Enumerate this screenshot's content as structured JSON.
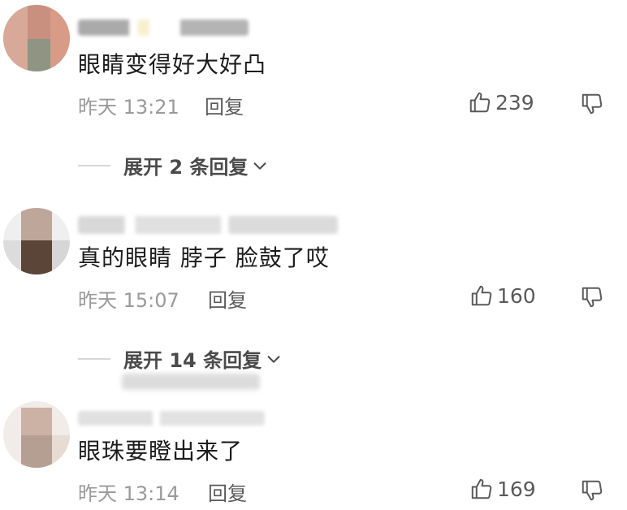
{
  "comments": [
    {
      "text": "眼睛变得好大好凸",
      "time": "昨天 13:21",
      "reply_label": "回复",
      "likes": "239",
      "expand_label": "展开 2 条回复"
    },
    {
      "text": "真的眼睛 脖子 脸鼓了哎",
      "time": "昨天 15:07",
      "reply_label": "回复",
      "likes": "160",
      "expand_label": "展开 14 条回复"
    },
    {
      "text": "眼珠要瞪出来了",
      "time": "昨天 13:14",
      "reply_label": "回复",
      "likes": "169"
    }
  ],
  "colors": {
    "text": "#1c1c1c",
    "meta": "#9a9a9a",
    "action": "#5a5a5a",
    "divider": "#d8d8d8"
  },
  "icons": [
    "thumbs-up-icon",
    "thumbs-down-icon",
    "chevron-down-icon"
  ]
}
